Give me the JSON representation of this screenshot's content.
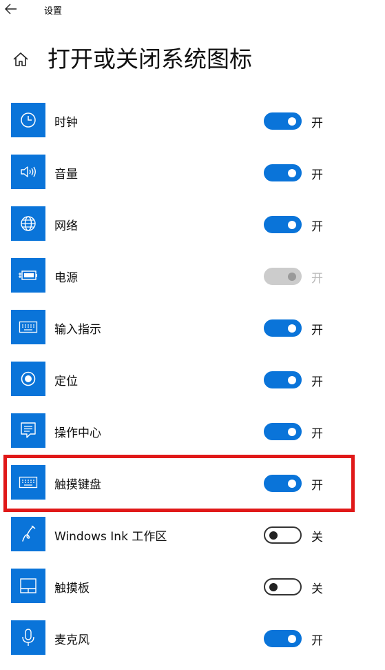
{
  "titlebar": {
    "title": "设置"
  },
  "header": {
    "title": "打开或关闭系统图标"
  },
  "icons": [
    {
      "label": "时钟",
      "icon": "clock-icon",
      "state": "on",
      "state_label": "开"
    },
    {
      "label": "音量",
      "icon": "volume-icon",
      "state": "on",
      "state_label": "开"
    },
    {
      "label": "网络",
      "icon": "globe-icon",
      "state": "on",
      "state_label": "开"
    },
    {
      "label": "电源",
      "icon": "battery-icon",
      "state": "disabled",
      "state_label": "开"
    },
    {
      "label": "输入指示",
      "icon": "keyboard-icon",
      "state": "on",
      "state_label": "开"
    },
    {
      "label": "定位",
      "icon": "location-icon",
      "state": "on",
      "state_label": "开"
    },
    {
      "label": "操作中心",
      "icon": "action-center-icon",
      "state": "on",
      "state_label": "开"
    },
    {
      "label": "触摸键盘",
      "icon": "keyboard-icon",
      "state": "on",
      "state_label": "开"
    },
    {
      "label": "Windows Ink 工作区",
      "icon": "pen-icon",
      "state": "off",
      "state_label": "关"
    },
    {
      "label": "触摸板",
      "icon": "touchpad-icon",
      "state": "off",
      "state_label": "关"
    },
    {
      "label": "麦克风",
      "icon": "microphone-icon",
      "state": "on",
      "state_label": "开"
    }
  ],
  "colors": {
    "accent": "#0a74d9",
    "highlight": "#e01818"
  }
}
